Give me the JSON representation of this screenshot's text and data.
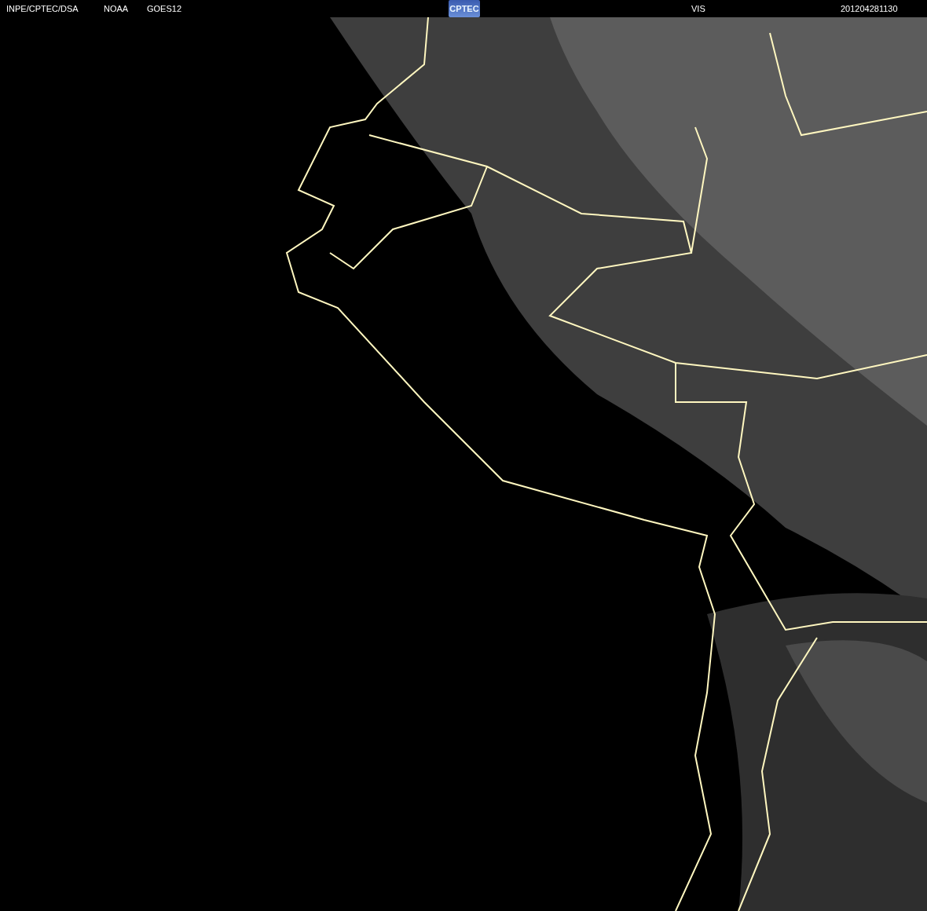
{
  "header": {
    "source": "INPE/CPTEC/DSA",
    "agency": "NOAA",
    "satellite": "GOES12",
    "logo": "CPTEC",
    "channel": "VIS",
    "timestamp": "201204281130"
  }
}
